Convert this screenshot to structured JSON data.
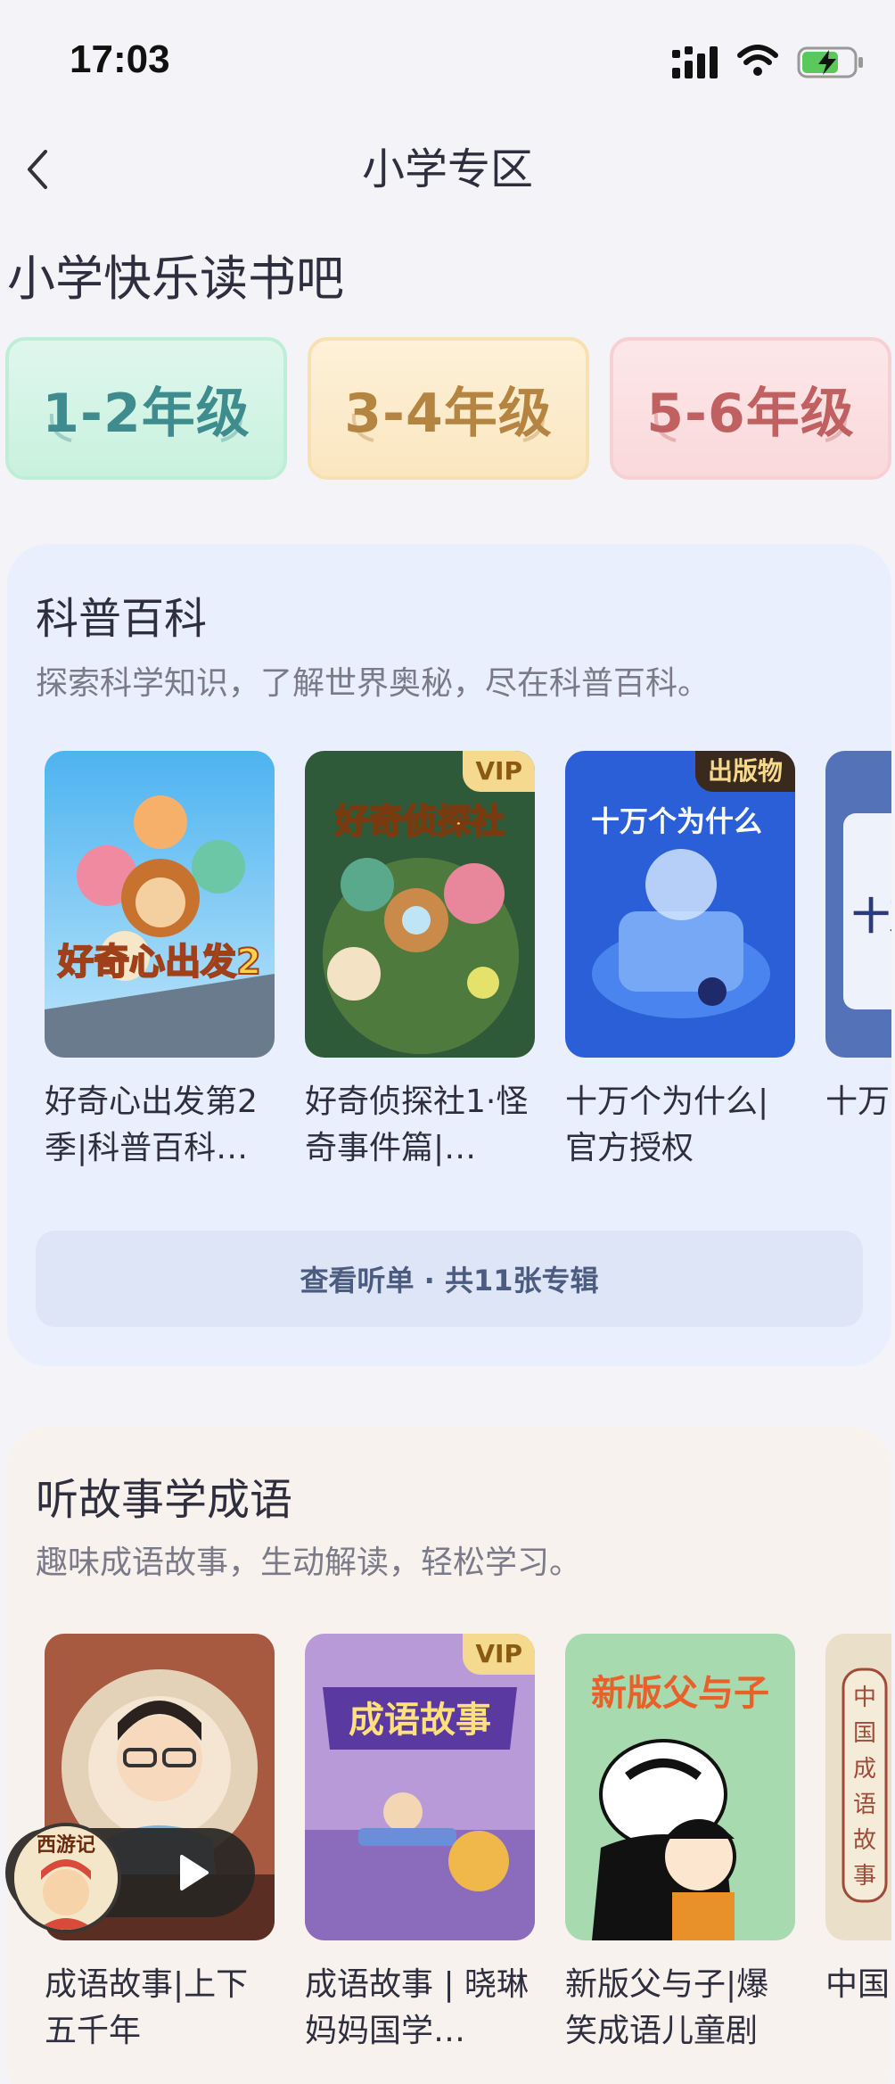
{
  "status_bar": {
    "time": "17:03"
  },
  "nav": {
    "title": "小学专区"
  },
  "section": {
    "title": "小学快乐读书吧"
  },
  "grades": [
    {
      "label": "1-2年级",
      "color": "#3e8c8e"
    },
    {
      "label": "3-4年级",
      "color": "#b58440"
    },
    {
      "label": "5-6年级",
      "color": "#c06060"
    }
  ],
  "science": {
    "title": "科普百科",
    "desc": "探索科学知识，了解世界奥秘，尽在科普百科。",
    "albums": [
      {
        "name": "好奇心出发第2季|科普百科…",
        "cover_text": "好奇心出发2",
        "tag": ""
      },
      {
        "name": "好奇侦探社1·怪奇事件篇|…",
        "cover_text": "好奇侦探社",
        "tag": "VIP"
      },
      {
        "name": "十万个为什么|官方授权",
        "cover_text": "十万个为什么",
        "tag": "出版物"
      },
      {
        "name": "十万（第",
        "cover_text": "十万",
        "tag": ""
      }
    ],
    "list_button": "查看听单 · 共11张专辑"
  },
  "idioms": {
    "title": "听故事学成语",
    "desc": "趣味成语故事，生动解读，轻松学习。",
    "albums": [
      {
        "name": "成语故事|上下五千年",
        "cover_text": "",
        "tag": ""
      },
      {
        "name": "成语故事 | 晓琳妈妈国学…",
        "cover_text": "成语故事",
        "tag": "VIP"
      },
      {
        "name": "新版父与子|爆笑成语儿童剧",
        "cover_text": "新版父与子",
        "tag": ""
      },
      {
        "name": "中国",
        "cover_text": "中国成语故事",
        "tag": ""
      }
    ]
  },
  "mini_player": {
    "cover_text": "西游记"
  },
  "colors": {
    "accent": "#4b5c80",
    "card_blue": "#eaeffd",
    "card_warm": "#f8f2ee",
    "vip": "#f4d98f"
  }
}
